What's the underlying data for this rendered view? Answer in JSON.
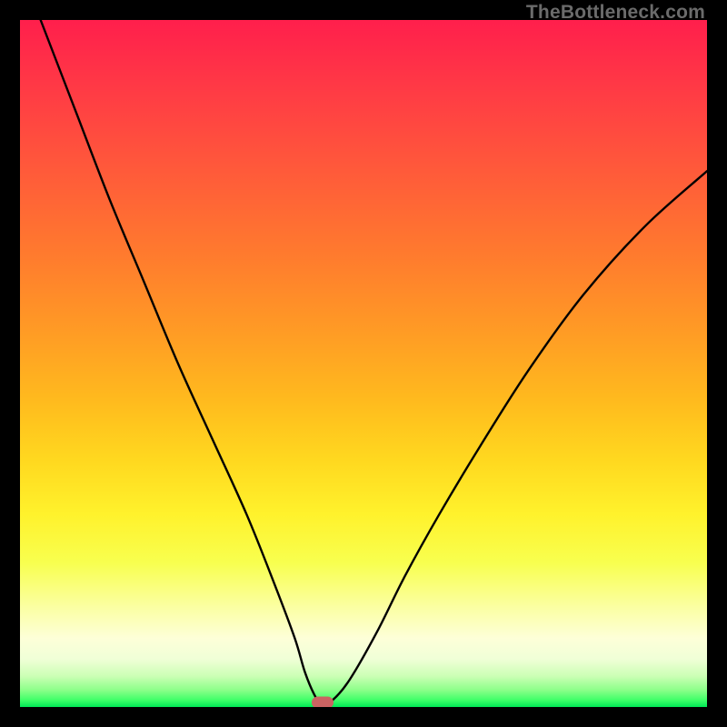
{
  "watermark": "TheBottleneck.com",
  "chart_data": {
    "type": "line",
    "title": "",
    "xlabel": "",
    "ylabel": "",
    "xlim": [
      0,
      100
    ],
    "ylim": [
      0,
      100
    ],
    "grid": false,
    "series": [
      {
        "name": "bottleneck-curve",
        "x": [
          3,
          8,
          13,
          18,
          23,
          28,
          33,
          37,
          40,
          41.5,
          43,
          44,
          45.5,
          48,
          52,
          56,
          61,
          67,
          74,
          82,
          91,
          100
        ],
        "y": [
          100,
          87,
          74,
          62,
          50,
          39,
          28,
          18,
          10,
          5,
          1.5,
          0.5,
          1,
          4,
          11,
          19,
          28,
          38,
          49,
          60,
          70,
          78
        ]
      }
    ],
    "marker": {
      "x": 44,
      "y": 0.7
    },
    "background_gradient": {
      "top_color": "#ff1f4c",
      "mid_color": "#ffe433",
      "bottom_color": "#00e756"
    }
  }
}
